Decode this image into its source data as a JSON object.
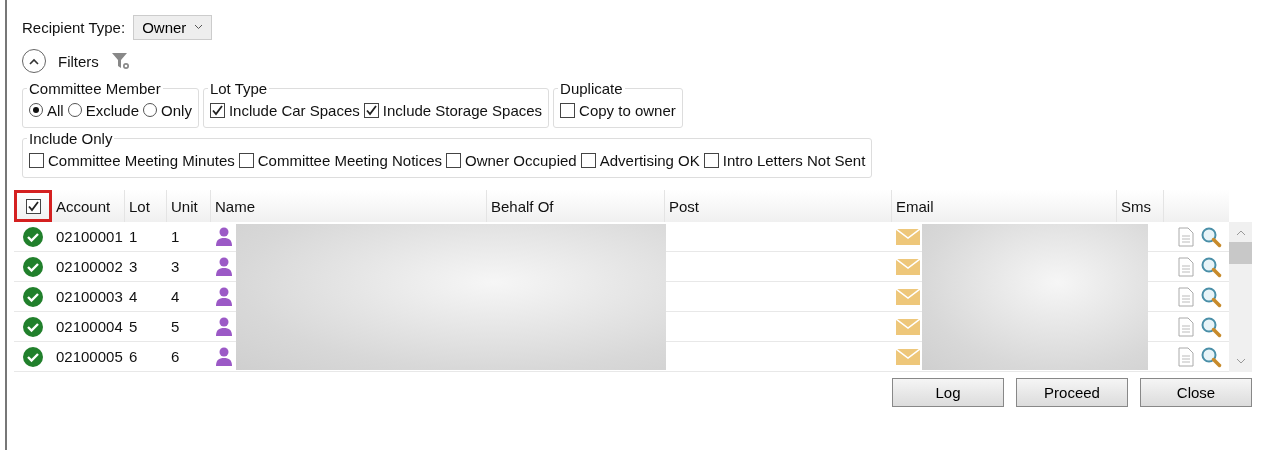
{
  "recipient_type": {
    "label": "Recipient Type:",
    "value": "Owner"
  },
  "filters": {
    "label": "Filters",
    "expanded": true
  },
  "groups": [
    {
      "title": "Committee Member",
      "kind": "radio",
      "options": [
        {
          "label": "All",
          "selected": true
        },
        {
          "label": "Exclude",
          "selected": false
        },
        {
          "label": "Only",
          "selected": false
        }
      ]
    },
    {
      "title": "Lot Type",
      "kind": "checkbox",
      "options": [
        {
          "label": "Include Car Spaces",
          "checked": true
        },
        {
          "label": "Include Storage Spaces",
          "checked": true
        }
      ]
    },
    {
      "title": "Duplicate",
      "kind": "checkbox",
      "options": [
        {
          "label": "Copy to owner",
          "checked": false
        }
      ]
    }
  ],
  "include_only": {
    "title": "Include Only",
    "options": [
      {
        "label": "Committee Meeting Minutes",
        "checked": false
      },
      {
        "label": "Committee Meeting Notices",
        "checked": false
      },
      {
        "label": "Owner Occupied",
        "checked": false
      },
      {
        "label": "Advertising OK",
        "checked": false
      },
      {
        "label": "Intro Letters Not Sent",
        "checked": false
      }
    ]
  },
  "table": {
    "select_all": true,
    "columns": [
      "Account",
      "Lot",
      "Unit",
      "Name",
      "Behalf Of",
      "Post",
      "Email",
      "Sms"
    ],
    "rows": [
      {
        "checked": true,
        "account": "02100001",
        "lot": "1",
        "unit": "1"
      },
      {
        "checked": true,
        "account": "02100002",
        "lot": "3",
        "unit": "3"
      },
      {
        "checked": true,
        "account": "02100003",
        "lot": "4",
        "unit": "4"
      },
      {
        "checked": true,
        "account": "02100004",
        "lot": "5",
        "unit": "5"
      },
      {
        "checked": true,
        "account": "02100005",
        "lot": "6",
        "unit": "6"
      }
    ]
  },
  "buttons": [
    "Log",
    "Proceed",
    "Close"
  ]
}
